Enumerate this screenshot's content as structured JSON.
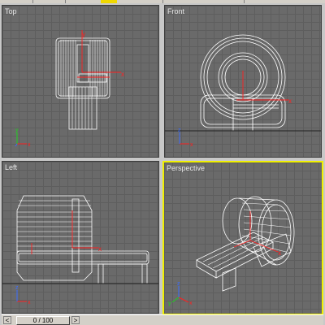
{
  "viewports": {
    "top": {
      "label": "Top"
    },
    "front": {
      "label": "Front"
    },
    "left": {
      "label": "Left"
    },
    "perspective": {
      "label": "Perspective"
    }
  },
  "time_slider": {
    "frame_text": "0 / 100",
    "prev_icon": "chevron-left-icon",
    "next_icon": "chevron-right-icon"
  },
  "colors": {
    "viewport_bg": "#6a6a6a",
    "grid": "#5e5e5e",
    "active_border": "#f0f000",
    "wireframe": "#ffffff",
    "gizmo_x": "#ff2020",
    "gizmo_y": "#20d020",
    "gizmo_z": "#3a6cff"
  }
}
